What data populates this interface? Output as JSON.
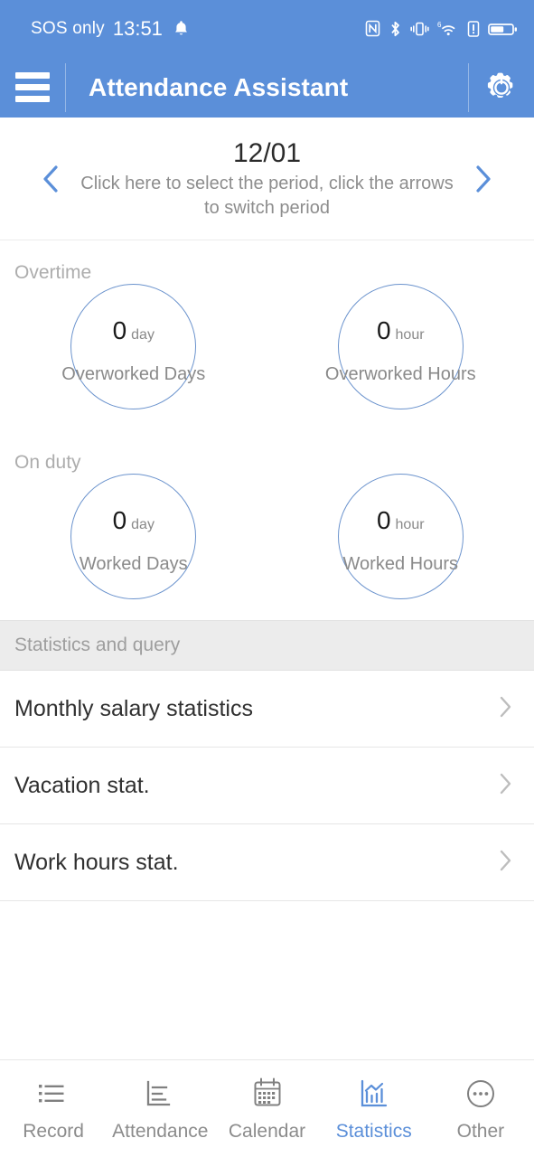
{
  "statusbar": {
    "carrier": "SOS only",
    "time": "13:51",
    "icons_left": [
      "bell-icon"
    ],
    "icons_right": [
      "nfc-icon",
      "bluetooth-icon",
      "vibrate-icon",
      "wifi-6-icon",
      "alert-icon",
      "battery-icon"
    ],
    "text_color": "#ffffff",
    "background": "#5b8fd9"
  },
  "appbar": {
    "menu_icon": "hamburger-menu-icon",
    "title": "Attendance Assistant",
    "action_icon": "settings-gear-icon",
    "background": "#5b8fd9"
  },
  "period": {
    "prev_icon": "chevron-left-icon",
    "next_icon": "chevron-right-icon",
    "date": "12/01",
    "hint": "Click here to select the period, click the arrows to switch period",
    "arrow_color": "#5b8fd9"
  },
  "sections": [
    {
      "title": "Overtime",
      "circles": [
        {
          "value": "0",
          "unit": "day",
          "label": "Overworked Days"
        },
        {
          "value": "0",
          "unit": "hour",
          "label": "Overworked Hours"
        }
      ]
    },
    {
      "title": "On duty",
      "circles": [
        {
          "value": "0",
          "unit": "day",
          "label": "Worked Days"
        },
        {
          "value": "0",
          "unit": "hour",
          "label": "Worked Hours"
        }
      ]
    }
  ],
  "list": {
    "header": "Statistics and query",
    "items": [
      {
        "label": "Monthly salary statistics",
        "chevron": "chevron-right-icon"
      },
      {
        "label": "Vacation stat.",
        "chevron": "chevron-right-icon"
      },
      {
        "label": "Work hours stat.",
        "chevron": "chevron-right-icon"
      }
    ]
  },
  "bottomnav": {
    "active_color": "#5b8fd9",
    "inactive_color": "#8c8c8c",
    "items": [
      {
        "label": "Record",
        "icon": "list-bullets-icon",
        "active": false
      },
      {
        "label": "Attendance",
        "icon": "bar-chart-icon",
        "active": false
      },
      {
        "label": "Calendar",
        "icon": "calendar-icon",
        "active": false
      },
      {
        "label": "Statistics",
        "icon": "statistics-chart-icon",
        "active": true
      },
      {
        "label": "Other",
        "icon": "ellipsis-circle-icon",
        "active": false
      }
    ]
  }
}
